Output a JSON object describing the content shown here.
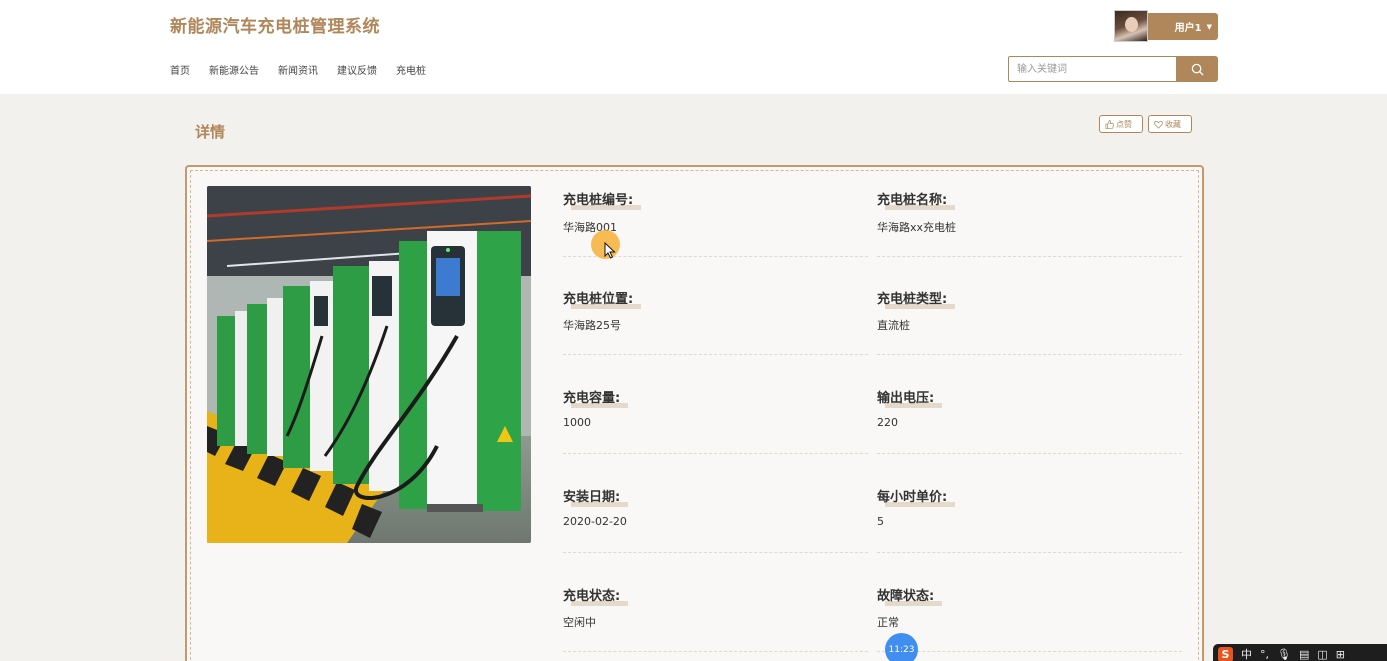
{
  "header": {
    "site_title": "新能源汽车充电桩管理系统",
    "nav": [
      "首页",
      "新能源公告",
      "新闻资讯",
      "建议反馈",
      "充电桩"
    ],
    "user_label": "用户1",
    "search_placeholder": "输入关键词"
  },
  "detail": {
    "title": "详情",
    "like_label": "点赞",
    "favorite_label": "收藏",
    "fields": [
      {
        "label": "充电桩编号:",
        "value": "华海路001"
      },
      {
        "label": "充电桩名称:",
        "value": "华海路xx充电桩"
      },
      {
        "label": "充电桩位置:",
        "value": "华海路25号"
      },
      {
        "label": "充电桩类型:",
        "value": "直流桩"
      },
      {
        "label": "充电容量:",
        "value": "1000"
      },
      {
        "label": "输出电压:",
        "value": "220"
      },
      {
        "label": "安装日期:",
        "value": "2020-02-20"
      },
      {
        "label": "每小时单价:",
        "value": "5"
      },
      {
        "label": "充电状态:",
        "value": "空闲中"
      },
      {
        "label": "故障状态:",
        "value": "正常"
      }
    ]
  },
  "overlay": {
    "time": "11:23",
    "ime_label": "中"
  },
  "colors": {
    "accent": "#b0875a",
    "background": "#f3f1ee"
  }
}
